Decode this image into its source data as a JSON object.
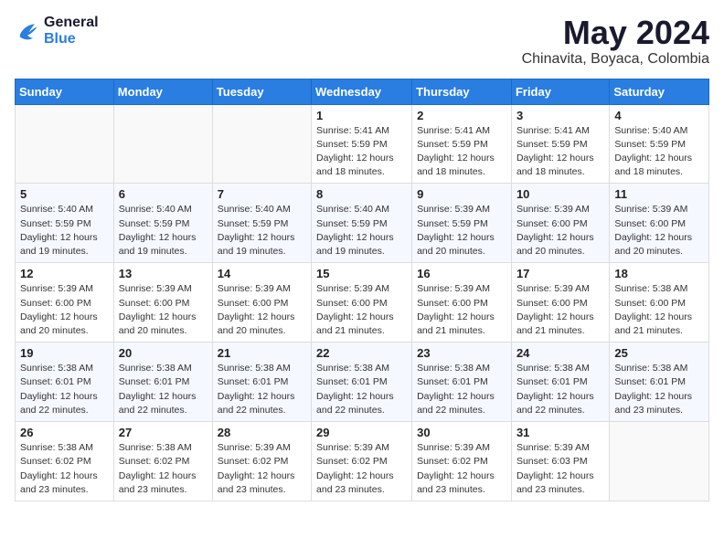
{
  "header": {
    "logo_line1": "General",
    "logo_line2": "Blue",
    "month": "May 2024",
    "location": "Chinavita, Boyaca, Colombia"
  },
  "days_of_week": [
    "Sunday",
    "Monday",
    "Tuesday",
    "Wednesday",
    "Thursday",
    "Friday",
    "Saturday"
  ],
  "weeks": [
    [
      {
        "day": "",
        "info": ""
      },
      {
        "day": "",
        "info": ""
      },
      {
        "day": "",
        "info": ""
      },
      {
        "day": "1",
        "info": "Sunrise: 5:41 AM\nSunset: 5:59 PM\nDaylight: 12 hours\nand 18 minutes."
      },
      {
        "day": "2",
        "info": "Sunrise: 5:41 AM\nSunset: 5:59 PM\nDaylight: 12 hours\nand 18 minutes."
      },
      {
        "day": "3",
        "info": "Sunrise: 5:41 AM\nSunset: 5:59 PM\nDaylight: 12 hours\nand 18 minutes."
      },
      {
        "day": "4",
        "info": "Sunrise: 5:40 AM\nSunset: 5:59 PM\nDaylight: 12 hours\nand 18 minutes."
      }
    ],
    [
      {
        "day": "5",
        "info": "Sunrise: 5:40 AM\nSunset: 5:59 PM\nDaylight: 12 hours\nand 19 minutes."
      },
      {
        "day": "6",
        "info": "Sunrise: 5:40 AM\nSunset: 5:59 PM\nDaylight: 12 hours\nand 19 minutes."
      },
      {
        "day": "7",
        "info": "Sunrise: 5:40 AM\nSunset: 5:59 PM\nDaylight: 12 hours\nand 19 minutes."
      },
      {
        "day": "8",
        "info": "Sunrise: 5:40 AM\nSunset: 5:59 PM\nDaylight: 12 hours\nand 19 minutes."
      },
      {
        "day": "9",
        "info": "Sunrise: 5:39 AM\nSunset: 5:59 PM\nDaylight: 12 hours\nand 20 minutes."
      },
      {
        "day": "10",
        "info": "Sunrise: 5:39 AM\nSunset: 6:00 PM\nDaylight: 12 hours\nand 20 minutes."
      },
      {
        "day": "11",
        "info": "Sunrise: 5:39 AM\nSunset: 6:00 PM\nDaylight: 12 hours\nand 20 minutes."
      }
    ],
    [
      {
        "day": "12",
        "info": "Sunrise: 5:39 AM\nSunset: 6:00 PM\nDaylight: 12 hours\nand 20 minutes."
      },
      {
        "day": "13",
        "info": "Sunrise: 5:39 AM\nSunset: 6:00 PM\nDaylight: 12 hours\nand 20 minutes."
      },
      {
        "day": "14",
        "info": "Sunrise: 5:39 AM\nSunset: 6:00 PM\nDaylight: 12 hours\nand 20 minutes."
      },
      {
        "day": "15",
        "info": "Sunrise: 5:39 AM\nSunset: 6:00 PM\nDaylight: 12 hours\nand 21 minutes."
      },
      {
        "day": "16",
        "info": "Sunrise: 5:39 AM\nSunset: 6:00 PM\nDaylight: 12 hours\nand 21 minutes."
      },
      {
        "day": "17",
        "info": "Sunrise: 5:39 AM\nSunset: 6:00 PM\nDaylight: 12 hours\nand 21 minutes."
      },
      {
        "day": "18",
        "info": "Sunrise: 5:38 AM\nSunset: 6:00 PM\nDaylight: 12 hours\nand 21 minutes."
      }
    ],
    [
      {
        "day": "19",
        "info": "Sunrise: 5:38 AM\nSunset: 6:01 PM\nDaylight: 12 hours\nand 22 minutes."
      },
      {
        "day": "20",
        "info": "Sunrise: 5:38 AM\nSunset: 6:01 PM\nDaylight: 12 hours\nand 22 minutes."
      },
      {
        "day": "21",
        "info": "Sunrise: 5:38 AM\nSunset: 6:01 PM\nDaylight: 12 hours\nand 22 minutes."
      },
      {
        "day": "22",
        "info": "Sunrise: 5:38 AM\nSunset: 6:01 PM\nDaylight: 12 hours\nand 22 minutes."
      },
      {
        "day": "23",
        "info": "Sunrise: 5:38 AM\nSunset: 6:01 PM\nDaylight: 12 hours\nand 22 minutes."
      },
      {
        "day": "24",
        "info": "Sunrise: 5:38 AM\nSunset: 6:01 PM\nDaylight: 12 hours\nand 22 minutes."
      },
      {
        "day": "25",
        "info": "Sunrise: 5:38 AM\nSunset: 6:01 PM\nDaylight: 12 hours\nand 23 minutes."
      }
    ],
    [
      {
        "day": "26",
        "info": "Sunrise: 5:38 AM\nSunset: 6:02 PM\nDaylight: 12 hours\nand 23 minutes."
      },
      {
        "day": "27",
        "info": "Sunrise: 5:38 AM\nSunset: 6:02 PM\nDaylight: 12 hours\nand 23 minutes."
      },
      {
        "day": "28",
        "info": "Sunrise: 5:39 AM\nSunset: 6:02 PM\nDaylight: 12 hours\nand 23 minutes."
      },
      {
        "day": "29",
        "info": "Sunrise: 5:39 AM\nSunset: 6:02 PM\nDaylight: 12 hours\nand 23 minutes."
      },
      {
        "day": "30",
        "info": "Sunrise: 5:39 AM\nSunset: 6:02 PM\nDaylight: 12 hours\nand 23 minutes."
      },
      {
        "day": "31",
        "info": "Sunrise: 5:39 AM\nSunset: 6:03 PM\nDaylight: 12 hours\nand 23 minutes."
      },
      {
        "day": "",
        "info": ""
      }
    ]
  ]
}
